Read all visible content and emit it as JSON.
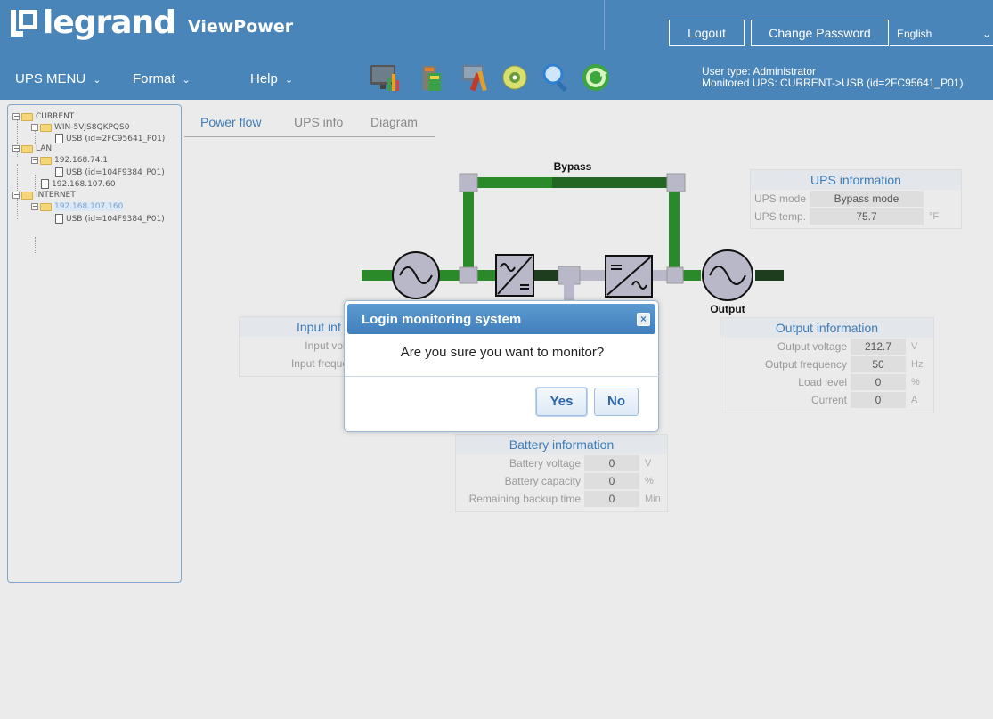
{
  "header": {
    "brand": "legrand",
    "app_name": "ViewPower",
    "logout_label": "Logout",
    "change_password_label": "Change Password",
    "language": "English"
  },
  "menus": {
    "ups_menu": "UPS MENU",
    "format": "Format",
    "help": "Help"
  },
  "toolbar_icons": [
    "monitor-icon",
    "ups-device-icon",
    "tools-icon",
    "cd-icon",
    "search-icon",
    "refresh-icon"
  ],
  "user_info": {
    "line1": "User type: Administrator",
    "line2": "Monitored UPS: CURRENT->USB (id=2FC95641_P01)"
  },
  "tree": {
    "current": "CURRENT",
    "win_host": "WIN-5VJS8QKPQS0",
    "usb_current": "USB (id=2FC95641_P01)",
    "lan": "LAN",
    "lan_host": "192.168.74.1",
    "usb_lan": "USB (id=104F9384_P01)",
    "lan_host2": "192.168.107.60",
    "internet": "INTERNET",
    "internet_host": "192.168.107.160",
    "usb_internet": "USB (id=104F9384_P01)"
  },
  "tabs": {
    "power_flow": "Power flow",
    "ups_info": "UPS info",
    "diagram": "Diagram"
  },
  "diagram": {
    "bypass_label": "Bypass",
    "output_label": "Output",
    "colors": {
      "green": "#2a8a2a",
      "dark": "#1e3d1e",
      "gray": "#b8b8c0"
    }
  },
  "ups_information": {
    "title": "UPS information",
    "mode_label": "UPS mode",
    "mode_value": "Bypass mode",
    "temp_label": "UPS temp.",
    "temp_value": "75.7",
    "temp_unit": "°F"
  },
  "input_information": {
    "title": "Input inf",
    "voltage_label": "Input volt",
    "frequency_label": "Input freque"
  },
  "output_information": {
    "title": "Output information",
    "voltage_label": "Output voltage",
    "voltage_value": "212.7",
    "voltage_unit": "V",
    "frequency_label": "Output frequency",
    "frequency_value": "50",
    "frequency_unit": "Hz",
    "load_label": "Load level",
    "load_value": "0",
    "load_unit": "%",
    "current_label": "Current",
    "current_value": "0",
    "current_unit": "A"
  },
  "battery_information": {
    "title": "Battery information",
    "voltage_label": "Battery voltage",
    "voltage_value": "0",
    "voltage_unit": "V",
    "capacity_label": "Battery capacity",
    "capacity_value": "0",
    "capacity_unit": "%",
    "backup_label": "Remaining backup time",
    "backup_value": "0",
    "backup_unit": "Min"
  },
  "modal": {
    "title": "Login monitoring system",
    "message": "Are you sure you want to monitor?",
    "yes_label": "Yes",
    "no_label": "No",
    "close_glyph": "×"
  }
}
